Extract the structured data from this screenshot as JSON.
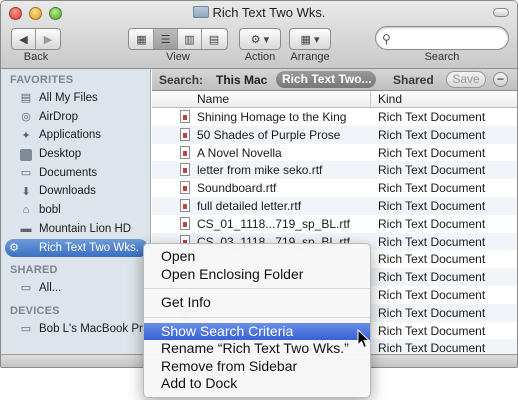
{
  "window": {
    "title": "Rich Text Two Wks."
  },
  "toolbar": {
    "back_label": "Back",
    "view_label": "View",
    "action_label": "Action",
    "arrange_label": "Arrange",
    "search_label": "Search",
    "search_placeholder": ""
  },
  "sidebar": {
    "favorites_header": "FAVORITES",
    "favorites": [
      {
        "label": "All My Files",
        "icon": "all-files-icon"
      },
      {
        "label": "AirDrop",
        "icon": "airdrop-icon"
      },
      {
        "label": "Applications",
        "icon": "applications-icon"
      },
      {
        "label": "Desktop",
        "icon": "desktop-icon"
      },
      {
        "label": "Documents",
        "icon": "documents-icon"
      },
      {
        "label": "Downloads",
        "icon": "downloads-icon"
      },
      {
        "label": "bobl",
        "icon": "home-icon"
      },
      {
        "label": "Mountain Lion HD",
        "icon": "hard-disk-icon"
      },
      {
        "label": "Rich Text Two Wks.",
        "icon": "smart-folder-icon",
        "selected": true
      }
    ],
    "shared_header": "SHARED",
    "shared": [
      {
        "label": "All...",
        "icon": "network-icon"
      }
    ],
    "devices_header": "DEVICES",
    "devices": [
      {
        "label": "Bob L's MacBook Pro",
        "icon": "laptop-icon"
      }
    ]
  },
  "scope_bar": {
    "search_label": "Search:",
    "this_mac": "This Mac",
    "selected_scope": "Rich Text Two...",
    "shared": "Shared",
    "save": "Save",
    "remove": "−"
  },
  "list": {
    "col_name": "Name",
    "col_kind": "Kind",
    "rows": [
      {
        "name": "Shining Homage to the King",
        "kind": "Rich Text Document"
      },
      {
        "name": "50 Shades of Purple Prose",
        "kind": "Rich Text Document"
      },
      {
        "name": "A Novel Novella",
        "kind": "Rich Text Document"
      },
      {
        "name": "letter from mike seko.rtf",
        "kind": "Rich Text Document"
      },
      {
        "name": "Soundboard.rtf",
        "kind": "Rich Text Document"
      },
      {
        "name": "full detailed letter.rtf",
        "kind": "Rich Text Document"
      },
      {
        "name": "CS_01_1118...719_sp_BL.rtf",
        "kind": "Rich Text Document"
      },
      {
        "name": "CS_03_1118...719_sp_BL.rtf",
        "kind": "Rich Text Document"
      },
      {
        "name": "",
        "kind": "Rich Text Document"
      },
      {
        "name": "",
        "kind": "Rich Text Document"
      },
      {
        "name": "",
        "kind": "Rich Text Document"
      },
      {
        "name": "",
        "kind": "Rich Text Document"
      },
      {
        "name": "",
        "kind": "Rich Text Document"
      },
      {
        "name": "",
        "kind": "Rich Text Document"
      }
    ]
  },
  "context_menu": {
    "open": "Open",
    "open_enclosing": "Open Enclosing Folder",
    "get_info": "Get Info",
    "show_criteria": "Show Search Criteria",
    "rename": "Rename “Rich Text Two Wks.”",
    "remove_sidebar": "Remove from Sidebar",
    "add_dock": "Add to Dock"
  },
  "colors": {
    "selection": "#3a6fc2",
    "menu_highlight": "#3660d6",
    "sidebar_bg": "#dde4eb"
  }
}
